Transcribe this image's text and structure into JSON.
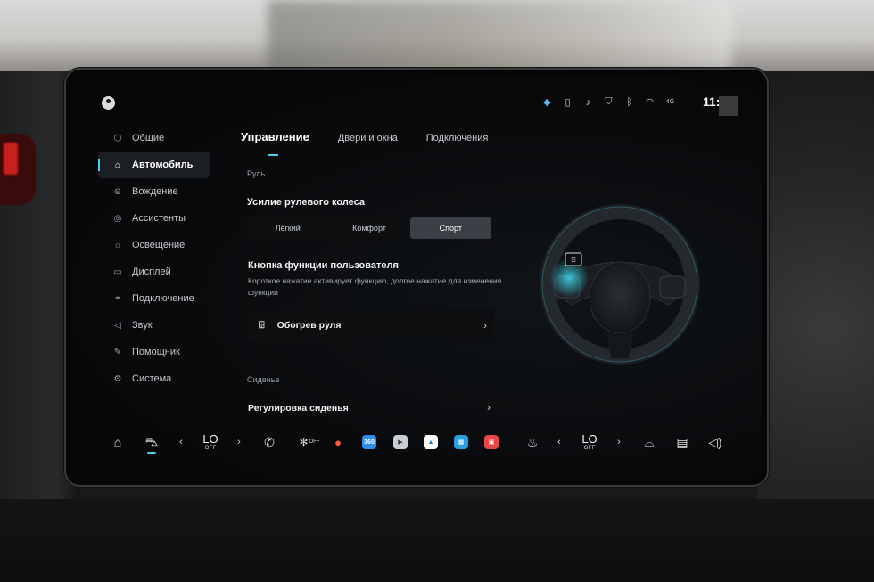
{
  "status_bar": {
    "time": "11:",
    "icons": [
      "assistant-dot-icon",
      "vibrate-icon",
      "bell-icon",
      "shield-icon",
      "bluetooth-icon",
      "wifi-icon",
      "cellular-icon"
    ],
    "cell_label": "4G"
  },
  "sidebar": {
    "items": [
      {
        "label": "Общие",
        "icon": "cube-icon",
        "glyph": "⬡"
      },
      {
        "label": "Автомобиль",
        "icon": "car-icon",
        "glyph": "⌂"
      },
      {
        "label": "Вождение",
        "icon": "steering-icon",
        "glyph": "⊜"
      },
      {
        "label": "Ассистенты",
        "icon": "assist-icon",
        "glyph": "◎"
      },
      {
        "label": "Освещение",
        "icon": "light-icon",
        "glyph": "☼"
      },
      {
        "label": "Дисплей",
        "icon": "display-icon",
        "glyph": "▭"
      },
      {
        "label": "Подключение",
        "icon": "link-icon",
        "glyph": "⚭"
      },
      {
        "label": "Звук",
        "icon": "sound-icon",
        "glyph": "◁"
      },
      {
        "label": "Помощник",
        "icon": "helper-icon",
        "glyph": "✎"
      },
      {
        "label": "Система",
        "icon": "gear-icon",
        "glyph": "⚙"
      }
    ],
    "active_index": 1
  },
  "tabs": {
    "items": [
      "Управление",
      "Двери и окна",
      "Подключения"
    ],
    "active_index": 0
  },
  "content": {
    "steering_section": "Руль",
    "steering_force_title": "Усилие рулевого колеса",
    "steering_modes": [
      "Лёгкий",
      "Комфорт",
      "Спорт"
    ],
    "steering_mode_selected": "Спорт",
    "custom_button_title": "Кнопка функции пользователя",
    "custom_button_desc": "Короткое нажатие активирует функцию, долгое нажатие для изменения функции",
    "custom_button_value": "Обогрев руля",
    "seat_section": "Сиденье",
    "seat_adjust": "Регулировка сиденья"
  },
  "dock": {
    "left_temp": "LO",
    "left_fan": "OFF",
    "fan_state": "OFF",
    "right_temp": "LO",
    "right_fan": "OFF",
    "app_360_label": "360"
  },
  "colors": {
    "accent": "#3fd2e6",
    "screen_bg": "#060607",
    "active_segment": "#3a3f45"
  }
}
